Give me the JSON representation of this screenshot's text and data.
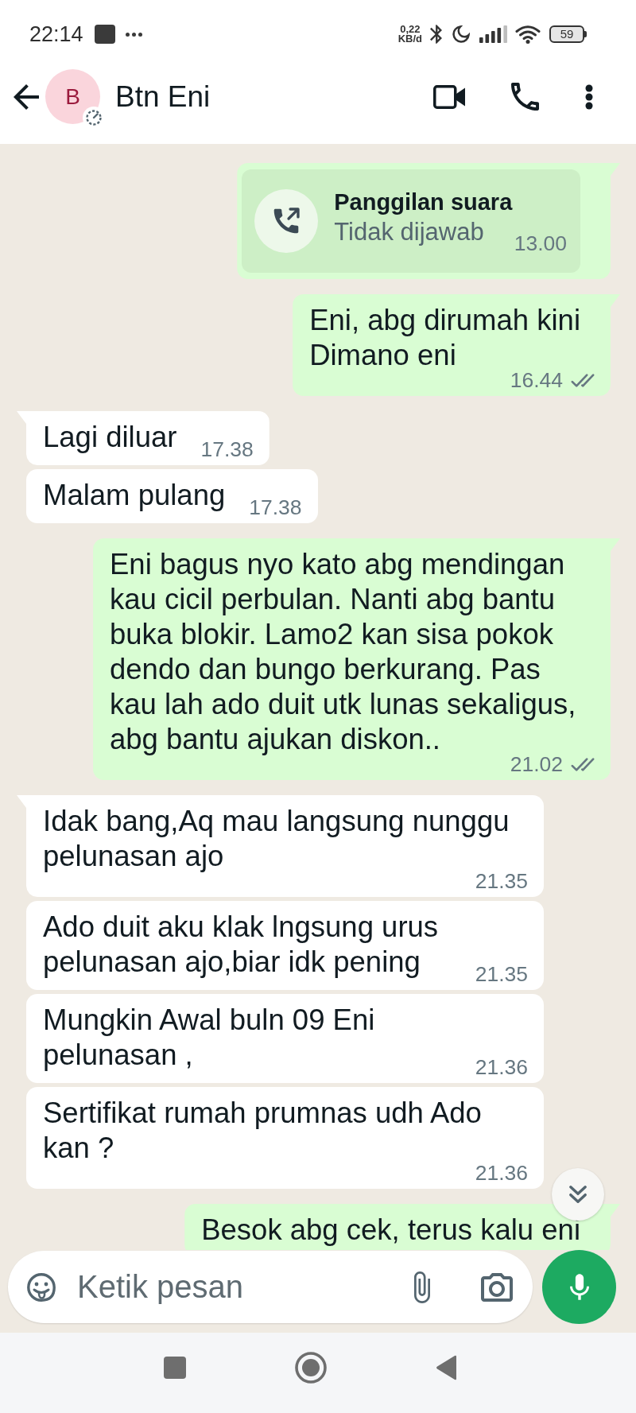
{
  "status_bar": {
    "time": "22:14",
    "network_speed": "0,22",
    "network_speed_unit": "KB/d",
    "battery": "59"
  },
  "header": {
    "avatar_letter": "B",
    "name": "Btn Eni"
  },
  "messages": [
    {
      "kind": "call",
      "outgoing": true,
      "tail": true,
      "title": "Panggilan suara",
      "subtitle": "Tidak dijawab",
      "time": "13.00"
    },
    {
      "kind": "text",
      "outgoing": true,
      "tail": true,
      "text": "Eni, abg dirumah kini\nDimano eni",
      "time": "16.44",
      "delivered": true,
      "read": false
    },
    {
      "kind": "text",
      "outgoing": false,
      "tail": true,
      "text": "Lagi diluar",
      "time": "17.38"
    },
    {
      "kind": "text",
      "outgoing": false,
      "tail": false,
      "text": "Malam pulang",
      "time": "17.38"
    },
    {
      "kind": "text",
      "outgoing": true,
      "tail": true,
      "text": "Eni bagus nyo kato abg mendingan kau cicil perbulan. Nanti abg bantu buka blokir. Lamo2 kan sisa pokok dendo dan bungo berkurang. Pas kau lah ado duit utk lunas sekaligus, abg bantu ajukan diskon..",
      "time": "21.02",
      "delivered": true,
      "read": false
    },
    {
      "kind": "text",
      "outgoing": false,
      "tail": true,
      "text": "Idak bang,Aq mau langsung nunggu pelunasan ajo",
      "time": "21.35"
    },
    {
      "kind": "text",
      "outgoing": false,
      "tail": false,
      "text": "Ado duit aku klak lngsung urus pelunasan ajo,biar idk pening",
      "time": "21.35"
    },
    {
      "kind": "text",
      "outgoing": false,
      "tail": false,
      "text": "Mungkin Awal buln 09 Eni pelunasan ,",
      "time": "21.36"
    },
    {
      "kind": "text",
      "outgoing": false,
      "tail": false,
      "text": "Sertifikat rumah prumnas udh Ado kan ?",
      "time": "21.36"
    },
    {
      "kind": "text",
      "outgoing": true,
      "tail": true,
      "text": "Besok abg cek, terus kalu eni"
    }
  ],
  "composer": {
    "placeholder": "Ketik pesan"
  }
}
